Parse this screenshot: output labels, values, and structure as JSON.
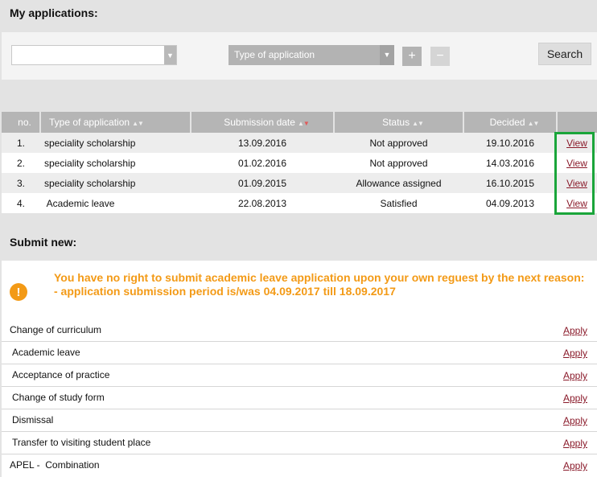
{
  "applications": {
    "title": "My applications:",
    "filter": {
      "combo_value": "",
      "type_select_label": "Type of application",
      "add_label": "+",
      "remove_label": "−",
      "search_label": "Search"
    },
    "table": {
      "headers": {
        "no": "no.",
        "type": "Type of application",
        "submission": "Submission date",
        "status": "Status",
        "decided": "Decided",
        "action": ""
      },
      "rows": [
        {
          "no": "1.",
          "type": "speciality scholarship",
          "submission": "13.09.2016",
          "status": "Not approved",
          "decided": "19.10.2016",
          "action": "View"
        },
        {
          "no": "2.",
          "type": "speciality scholarship",
          "submission": "01.02.2016",
          "status": "Not approved",
          "decided": "14.03.2016",
          "action": "View"
        },
        {
          "no": "3.",
          "type": "speciality scholarship",
          "submission": "01.09.2015",
          "status": "Allowance assigned",
          "decided": "16.10.2015",
          "action": "View"
        },
        {
          "no": "4.",
          "type": " Academic leave",
          "submission": "22.08.2013",
          "status": "Satisfied",
          "decided": "04.09.2013",
          "action": "View"
        }
      ]
    }
  },
  "submit_new": {
    "title": "Submit new:",
    "warning": {
      "icon": "exclamation-icon",
      "color": "#f39a16",
      "line1": "You have no right to submit academic leave application upon your own reguest by the next reason:",
      "line2": "- application submission period is/was 04.09.2017 till 18.09.2017"
    },
    "items": [
      {
        "label": "Change of curriculum",
        "action": "Apply"
      },
      {
        "label": "Academic leave",
        "action": "Apply"
      },
      {
        "label": "Acceptance of practice",
        "action": "Apply"
      },
      {
        "label": "Change of study form",
        "action": "Apply"
      },
      {
        "label": "Dismissal",
        "action": "Apply"
      },
      {
        "label": "Transfer to visiting student place",
        "action": "Apply"
      },
      {
        "label": "APEL -  Combination",
        "action": "Apply"
      }
    ]
  },
  "colors": {
    "highlight": "#1aa53a",
    "link": "#8a1a2a",
    "header_bg": "#b5b5b5"
  }
}
